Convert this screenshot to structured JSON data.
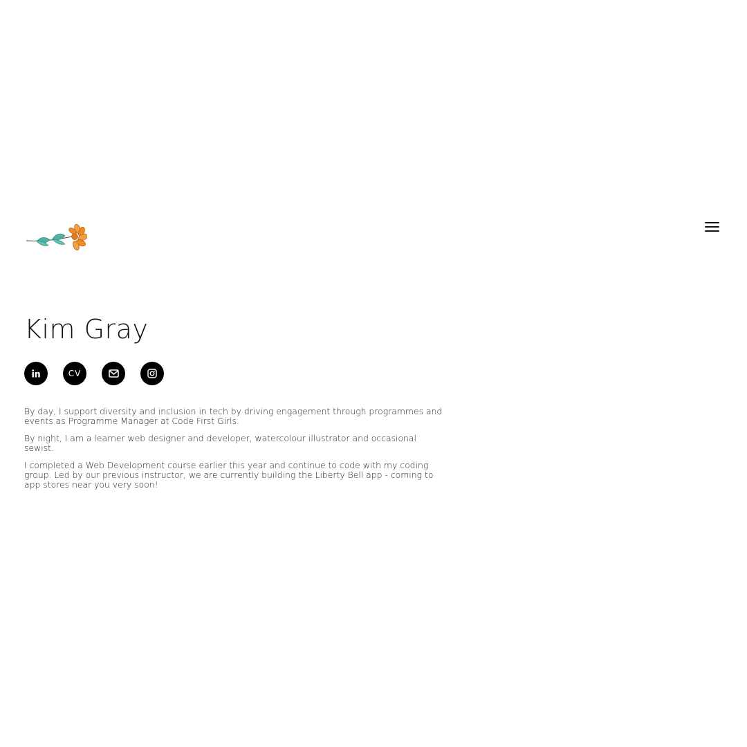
{
  "logo": {
    "icon": "flower-sprig-logo",
    "colors": {
      "petal": "#f08a24",
      "petal_outline": "#b35c12",
      "leaf": "#4fb0a5",
      "stem": "#444444"
    }
  },
  "nav": {
    "menu_icon": "hamburger-menu-icon"
  },
  "profile": {
    "name": "Kim Gray"
  },
  "socials": [
    {
      "icon": "linkedin-icon",
      "label": "in"
    },
    {
      "icon": "cv-icon",
      "label": "CV"
    },
    {
      "icon": "mail-icon"
    },
    {
      "icon": "instagram-icon"
    }
  ],
  "bio": {
    "p1": "By day, I support diversity and inclusion in tech by driving engagement through programmes and events as Programme Manager at Code First Girls.",
    "p2": "By night, I am a learner web designer and developer, watercolour illustrator and occasional sewist.",
    "p3": "I completed a Web Development course earlier this year and continue to code with my coding group. Led by our previous instructor, we are currently building the Liberty Bell app - coming to app stores near you very soon!"
  }
}
